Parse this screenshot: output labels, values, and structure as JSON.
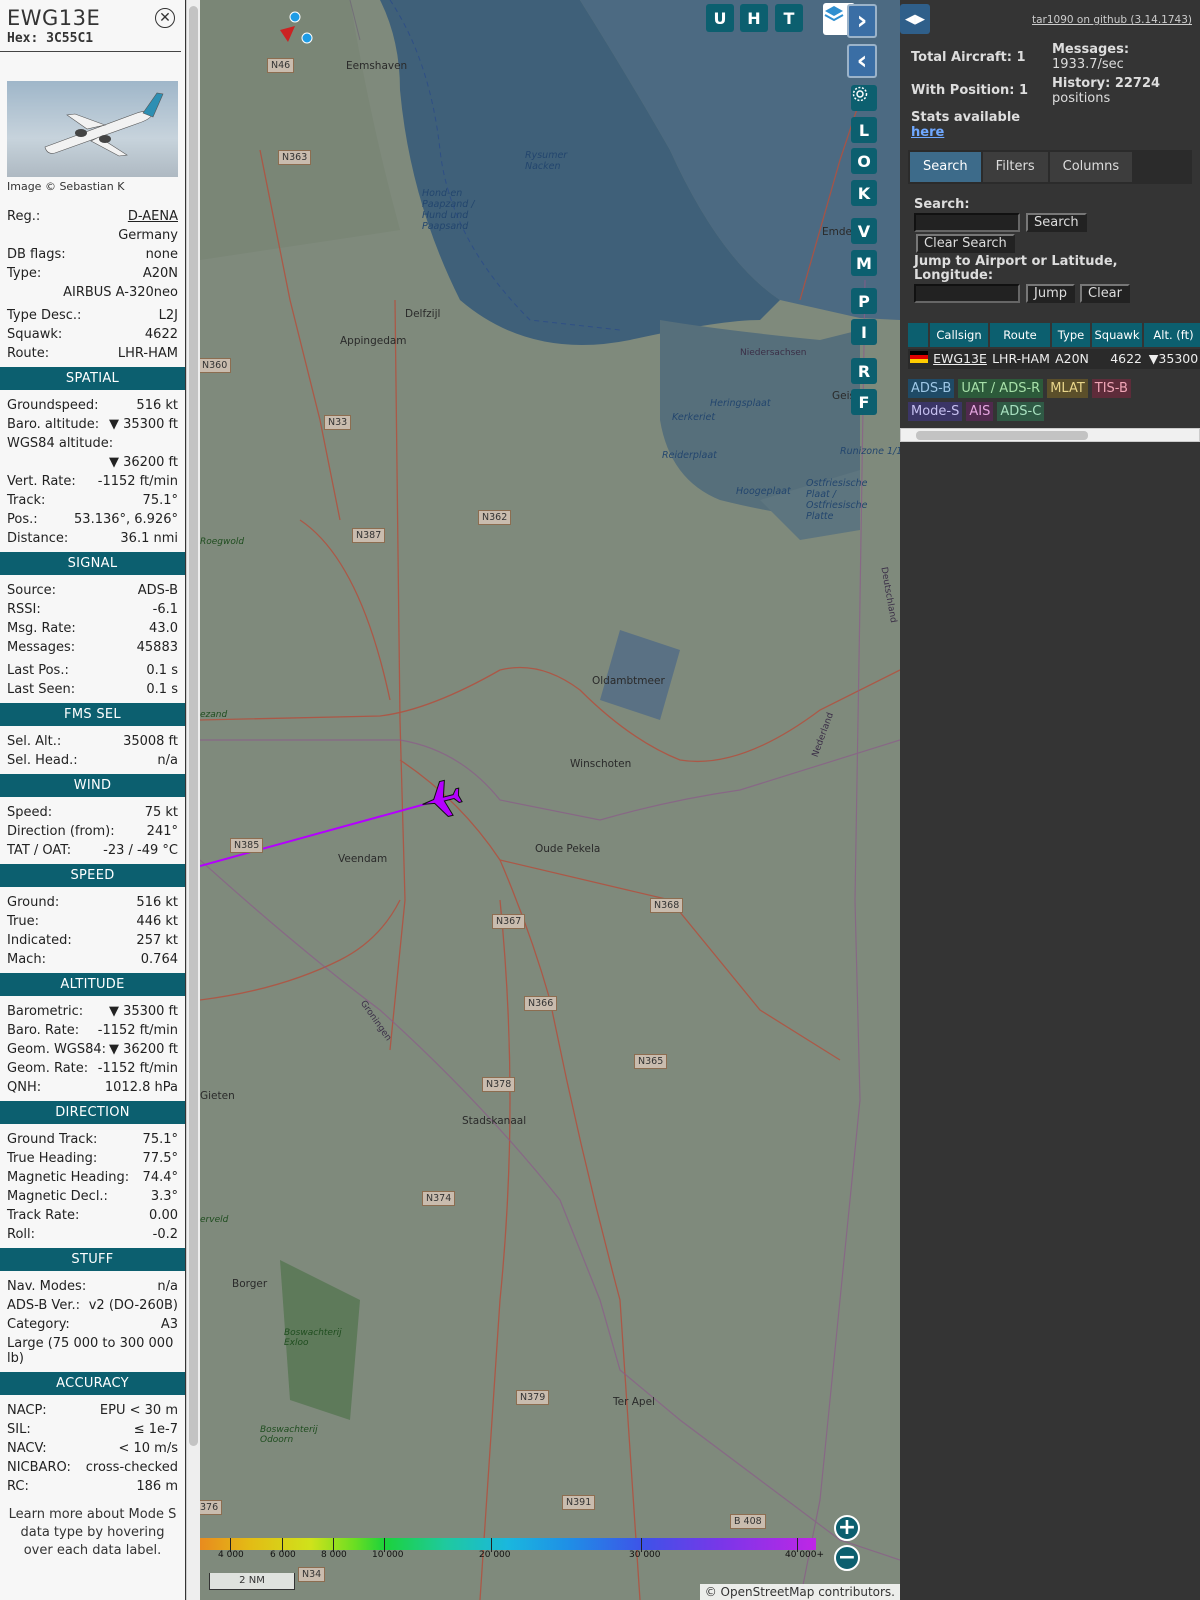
{
  "aircraft": {
    "callsign": "EWG13E",
    "hex_label": "Hex:",
    "hex": "3C55C1",
    "image_credit": "Image © Sebastian K"
  },
  "details": [
    {
      "k": "Reg.:",
      "v": "D-AENA",
      "link": true
    },
    {
      "k": "",
      "v": "Germany"
    },
    {
      "k": "DB flags:",
      "v": "none"
    },
    {
      "k": "Type:",
      "v": "A20N"
    },
    {
      "k": "",
      "v": "AIRBUS A-320neo"
    },
    {
      "k": "Type Desc.:",
      "v": "L2J",
      "gap": true
    },
    {
      "k": "Squawk:",
      "v": "4622"
    },
    {
      "k": "Route:",
      "v": "LHR-HAM"
    }
  ],
  "sections": [
    {
      "title": "SPATIAL",
      "rows": [
        {
          "k": "Groundspeed:",
          "v": "516 kt"
        },
        {
          "k": "Baro. altitude:",
          "v": "▼ 35300 ft"
        },
        {
          "k": "WGS84 altitude:",
          "v": ""
        },
        {
          "k": "",
          "v": "▼ 36200 ft"
        },
        {
          "k": "Vert. Rate:",
          "v": "-1152 ft/min"
        },
        {
          "k": "Track:",
          "v": "75.1°"
        },
        {
          "k": "Pos.:",
          "v": "53.136°, 6.926°"
        },
        {
          "k": "Distance:",
          "v": "36.1 nmi"
        }
      ]
    },
    {
      "title": "SIGNAL",
      "rows": [
        {
          "k": "Source:",
          "v": "ADS-B"
        },
        {
          "k": "RSSI:",
          "v": "-6.1"
        },
        {
          "k": "Msg. Rate:",
          "v": "43.0"
        },
        {
          "k": "Messages:",
          "v": "45883"
        },
        {
          "k": "Last Pos.:",
          "v": "0.1 s",
          "gap": true
        },
        {
          "k": "Last Seen:",
          "v": "0.1 s"
        }
      ]
    },
    {
      "title": "FMS SEL",
      "rows": [
        {
          "k": "Sel. Alt.:",
          "v": "35008 ft"
        },
        {
          "k": "Sel. Head.:",
          "v": "n/a"
        }
      ]
    },
    {
      "title": "WIND",
      "rows": [
        {
          "k": "Speed:",
          "v": "75 kt"
        },
        {
          "k": "Direction (from):",
          "v": "241°"
        },
        {
          "k": "TAT / OAT:",
          "v": "-23 / -49 °C"
        }
      ]
    },
    {
      "title": "SPEED",
      "rows": [
        {
          "k": "Ground:",
          "v": "516 kt"
        },
        {
          "k": "True:",
          "v": "446 kt"
        },
        {
          "k": "Indicated:",
          "v": "257 kt"
        },
        {
          "k": "Mach:",
          "v": "0.764"
        }
      ]
    },
    {
      "title": "ALTITUDE",
      "rows": [
        {
          "k": "Barometric:",
          "v": "▼ 35300 ft"
        },
        {
          "k": "Baro. Rate:",
          "v": "-1152 ft/min"
        },
        {
          "k": "Geom. WGS84:",
          "v": "▼ 36200 ft"
        },
        {
          "k": "Geom. Rate:",
          "v": "-1152 ft/min"
        },
        {
          "k": "QNH:",
          "v": "1012.8 hPa"
        }
      ]
    },
    {
      "title": "DIRECTION",
      "rows": [
        {
          "k": "Ground Track:",
          "v": "75.1°"
        },
        {
          "k": "True Heading:",
          "v": "77.5°"
        },
        {
          "k": "Magnetic Heading:",
          "v": "74.4°"
        },
        {
          "k": "Magnetic Decl.:",
          "v": "3.3°"
        },
        {
          "k": "Track Rate:",
          "v": "0.00"
        },
        {
          "k": "Roll:",
          "v": "-0.2"
        }
      ]
    },
    {
      "title": "STUFF",
      "rows": [
        {
          "k": "Nav. Modes:",
          "v": "n/a"
        },
        {
          "k": "ADS-B Ver.:",
          "v": "v2 (DO-260B)"
        },
        {
          "k": "Category:",
          "v": "A3"
        },
        {
          "k": "Large (75 000 to 300 000 lb)",
          "v": "",
          "multi": true
        }
      ]
    },
    {
      "title": "ACCURACY",
      "rows": [
        {
          "k": "NACP:",
          "v": "EPU < 30 m"
        },
        {
          "k": "SIL:",
          "v": "≤ 1e-7"
        },
        {
          "k": "NACV:",
          "v": "< 10 m/s"
        },
        {
          "k": "NICBARO:",
          "v": "cross-checked"
        },
        {
          "k": "RC:",
          "v": "186 m"
        }
      ]
    }
  ],
  "learn_more": "Learn more about Mode S data type by hovering over each data label.",
  "map": {
    "toggle_buttons": [
      "U",
      "H",
      "T"
    ],
    "side_buttons": [
      "L",
      "O",
      "K",
      "V",
      "M",
      "P",
      "I",
      "R",
      "F"
    ],
    "scale": "2 NM",
    "attribution": "© OpenStreetMap contributors.",
    "alt_ticks": [
      "4 000",
      "6 000",
      "8 000",
      "10 000",
      "20 000",
      "30 000",
      "40 000+"
    ],
    "places": [
      "Eemshaven",
      "Delfzijl",
      "Appingedam",
      "Winschoten",
      "Oude Pekela",
      "Veendam",
      "Stadskanaal",
      "Borger",
      "Ter Apel",
      "Gieten",
      "Emde",
      "Oldambtmeer",
      "Hond-en Paapzand / Hund und Paapsand",
      "Rysumer Nacken",
      "Heringsplaat",
      "Kerkeriet",
      "Reiderplaat",
      "Hoogeplaat",
      "Ostfriesische Plaat / Ostfriesische Platte",
      "Runizone 1/1",
      "Roegwold",
      "ezand",
      "Boswachterij Exloo",
      "Boswachterij Odoorn",
      "erveld",
      "Geis",
      "Deutschland",
      "Niedersachsen",
      "Nederland",
      "Groningen"
    ],
    "roads": [
      "N46",
      "N363",
      "N360",
      "N33",
      "N387",
      "N362",
      "N385",
      "N367",
      "N368",
      "N366",
      "N378",
      "N365",
      "N374",
      "N379",
      "N391",
      "N34",
      "B 408",
      "376"
    ]
  },
  "right": {
    "github": "tar1090 on github (3.14.1743)",
    "total_aircraft": "Total Aircraft: 1",
    "with_position": "With Position: 1",
    "messages_label": "Messages:",
    "messages_value": "1933.7/sec",
    "history_label": "History: 22724",
    "history_value": "positions",
    "stats_label": "Stats available",
    "stats_link": "here",
    "tabs": [
      "Search",
      "Filters",
      "Columns"
    ],
    "search_label": "Search:",
    "search_button": "Search",
    "clear_search": "Clear Search",
    "jump_label": "Jump to Airport or Latitude, Longitude:",
    "jump_button": "Jump",
    "clear_button": "Clear",
    "table_headers": [
      "",
      "Callsign",
      "Route",
      "Type",
      "Squawk",
      "Alt. (ft)"
    ],
    "table_row": {
      "callsign": "EWG13E",
      "route": "LHR-HAM",
      "type": "A20N",
      "squawk": "4622",
      "alt": "▼35300"
    },
    "sources": [
      {
        "label": "ADS-B",
        "bg": "#1f4a66",
        "fg": "#9ec7e6"
      },
      {
        "label": "UAT / ADS-R",
        "bg": "#2c5a3a",
        "fg": "#a6e0a8"
      },
      {
        "label": "MLAT",
        "bg": "#5b4f2a",
        "fg": "#e8d58a"
      },
      {
        "label": "TIS-B",
        "bg": "#5e2c3a",
        "fg": "#f0a5b6"
      },
      {
        "label": "Mode-S",
        "bg": "#3b3566",
        "fg": "#c6c0f0"
      },
      {
        "label": "AIS",
        "bg": "#502a4e",
        "fg": "#e6a6e0"
      },
      {
        "label": "ADS-C",
        "bg": "#2f5a45",
        "fg": "#a8e0c0"
      }
    ]
  },
  "colors": {
    "accent": "#0c5f6f",
    "track": "#b400ff",
    "sidebar_bg": "#f7f7f7",
    "panel_bg": "#343434"
  }
}
